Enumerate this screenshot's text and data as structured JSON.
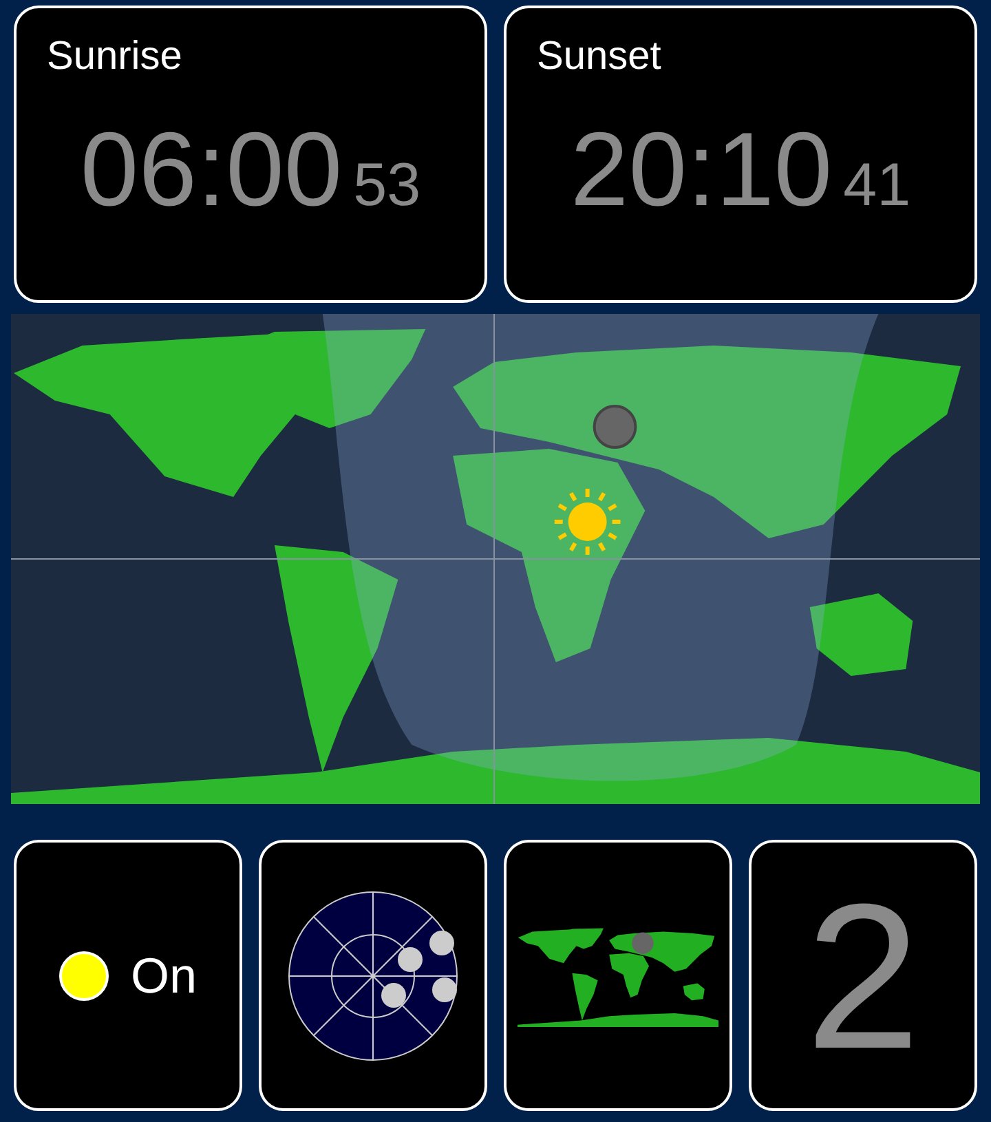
{
  "times": [
    {
      "label": "Sunrise",
      "time": "06:00",
      "seconds": "53"
    },
    {
      "label": "Sunset",
      "time": "20:10",
      "seconds": "41"
    }
  ],
  "tiles": [
    {
      "kind": "status",
      "on": true,
      "label": "On"
    },
    {
      "kind": "radar"
    },
    {
      "kind": "minimap"
    },
    {
      "kind": "number",
      "value": "2"
    }
  ]
}
